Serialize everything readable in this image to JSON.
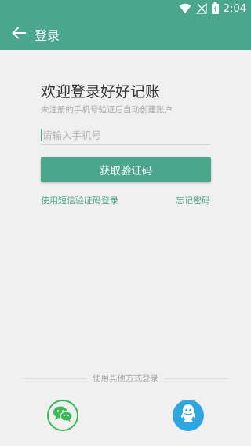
{
  "status_bar": {
    "time": "2:04",
    "icons": [
      "wifi-icon",
      "no-signal-icon",
      "battery-charging-icon"
    ]
  },
  "app_bar": {
    "title": "登录",
    "back_icon": "arrow-left-icon",
    "color": "#4aa68c"
  },
  "login": {
    "welcome": "欢迎登录好好记账",
    "subtitle": "未注册的手机号验证后自动创建账户",
    "phone_placeholder": "请输入手机号",
    "phone_value": "",
    "get_code_button": "获取验证码",
    "sms_login_link": "使用短信验证码登录",
    "forgot_password_link": "忘记密码"
  },
  "other_login": {
    "label": "使用其他方式登录",
    "options": [
      "wechat-icon",
      "qq-icon"
    ],
    "wechat_color": "#3cb95a",
    "qq_color": "#2fa6e0"
  }
}
